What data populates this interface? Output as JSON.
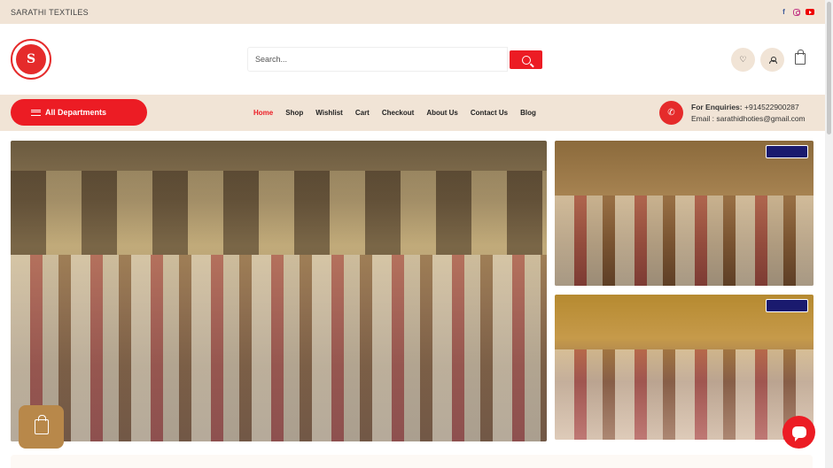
{
  "topbar": {
    "brand": "SARATHI TEXTILES",
    "social": [
      "facebook-icon",
      "instagram-icon",
      "youtube-icon"
    ]
  },
  "header": {
    "logo_text": "S",
    "search_placeholder": "Search..."
  },
  "nav": {
    "departments_label": "All Departments",
    "menu": [
      "Home",
      "Shop",
      "Wishlist",
      "Cart",
      "Checkout",
      "About Us",
      "Contact Us",
      "Blog"
    ],
    "active": "Home",
    "enquiry_label": "For Enquiries:",
    "enquiry_phone": "+914522900287",
    "email_label": "Email :",
    "email": "sarathidhoties@gmail.com"
  },
  "colors": {
    "accent": "#ec1c24",
    "beige": "#f1e4d6",
    "cart_float": "#b8884a"
  }
}
